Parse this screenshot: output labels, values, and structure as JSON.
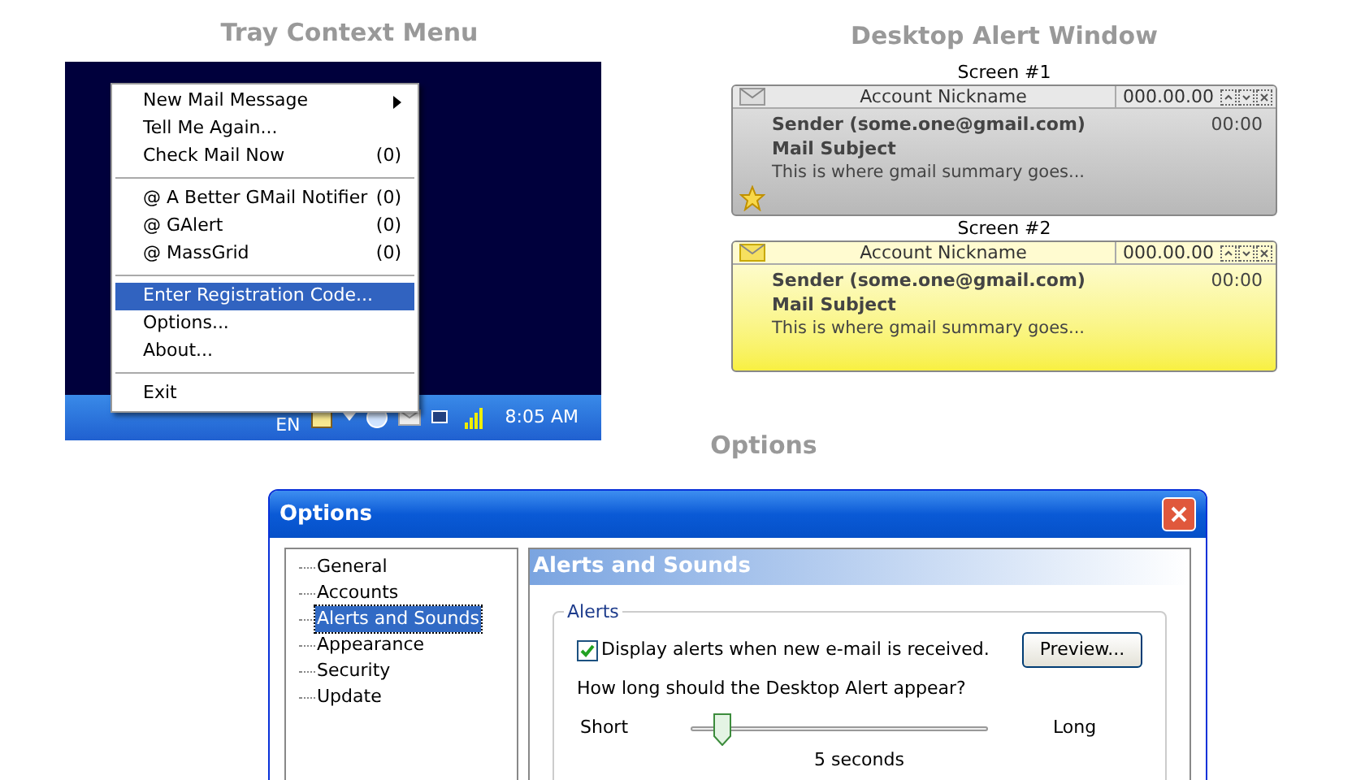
{
  "tray": {
    "heading": "Tray Context Menu",
    "menu": [
      {
        "kind": "item",
        "label": "New Mail Message",
        "submenu": true,
        "selected": false
      },
      {
        "kind": "item",
        "label": "Tell Me Again...",
        "selected": false
      },
      {
        "kind": "item",
        "label": "Check Mail Now",
        "count": "(0)",
        "selected": false
      },
      {
        "kind": "separator"
      },
      {
        "kind": "item",
        "label": "@ A Better GMail Notifier",
        "count": "(0)",
        "selected": false
      },
      {
        "kind": "item",
        "label": "@ GAlert",
        "count": "(0)",
        "selected": false
      },
      {
        "kind": "item",
        "label": "@ MassGrid",
        "count": "(0)",
        "selected": false
      },
      {
        "kind": "separator"
      },
      {
        "kind": "item",
        "label": "Enter Registration Code...",
        "selected": true
      },
      {
        "kind": "item",
        "label": "Options...",
        "selected": false
      },
      {
        "kind": "item",
        "label": "About...",
        "selected": false
      },
      {
        "kind": "separator"
      },
      {
        "kind": "item",
        "label": "Exit",
        "selected": false
      }
    ],
    "taskbar": {
      "language": "EN",
      "clock": "8:05 AM"
    }
  },
  "alerts": {
    "heading": "Desktop Alert Window",
    "screens": [
      {
        "label": "Screen #1",
        "kind": "plain",
        "account": "Account Nickname",
        "date": "000.00.00",
        "sender": "Sender (some.one@gmail.com)",
        "time": "00:00",
        "subject": "Mail Subject",
        "summary": "This is where gmail summary goes...",
        "starred": true
      },
      {
        "label": "Screen #2",
        "kind": "highlighted",
        "account": "Account Nickname",
        "date": "000.00.00",
        "sender": "Sender (some.one@gmail.com)",
        "time": "00:00",
        "subject": "Mail Subject",
        "summary": "This is where gmail summary goes...",
        "starred": false
      }
    ]
  },
  "options": {
    "heading": "Options",
    "title": "Options",
    "tree": [
      {
        "label": "General",
        "selected": false
      },
      {
        "label": "Accounts",
        "selected": false
      },
      {
        "label": "Alerts and Sounds",
        "selected": true
      },
      {
        "label": "Appearance",
        "selected": false
      },
      {
        "label": "Security",
        "selected": false
      },
      {
        "label": "Update",
        "selected": false
      }
    ],
    "panel_title": "Alerts and Sounds",
    "group": "Alerts",
    "display_alerts": {
      "label": "Display alerts when new e-mail is received.",
      "checked": true
    },
    "preview_button": "Preview...",
    "question": "How long should the Desktop Alert appear?",
    "duration": {
      "min_label": "Short",
      "max_label": "Long",
      "level": 0.08,
      "reading": "5 seconds"
    }
  }
}
